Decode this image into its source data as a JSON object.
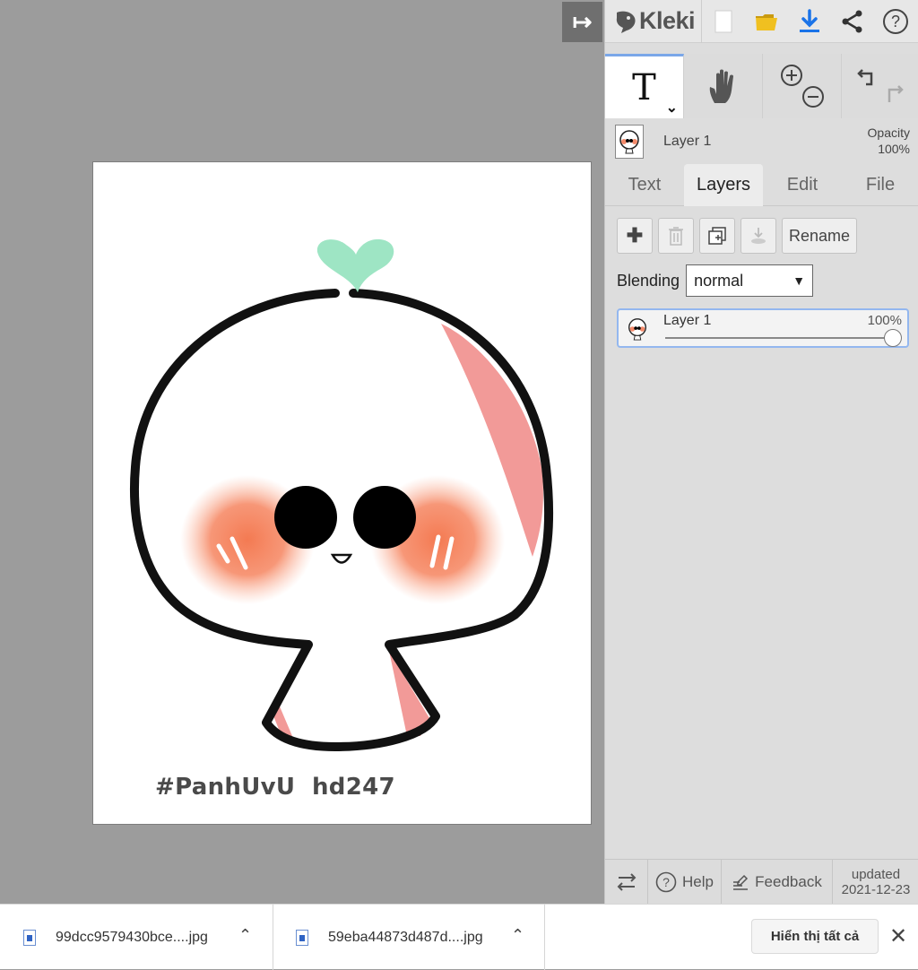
{
  "panel": {
    "app_name": "Kleki",
    "layer_name": "Layer 1",
    "opacity_label": "Opacity",
    "opacity_value": "100%",
    "tabs": [
      "Text",
      "Layers",
      "Edit",
      "File"
    ],
    "active_tab": "Layers",
    "rename_label": "Rename",
    "blending_label": "Blending",
    "blending_value": "normal",
    "layer_item": {
      "name": "Layer 1",
      "opacity": "100%",
      "opacity_fraction": 1.0
    },
    "help_label": "Help",
    "feedback_label": "Feedback",
    "updated_label": "updated",
    "updated_date": "2021-12-23"
  },
  "canvas": {
    "watermark": "#PanhUvU  hd247"
  },
  "downloads": {
    "file1": "99dcc9579430bce....jpg",
    "file2": "59eba44873d487d....jpg",
    "show_all": "Hiển thị tất cả"
  },
  "colors": {
    "accent": "#2f63c4",
    "download_icon": "#1a73e8",
    "folder": "#f0c020",
    "sprout": "#9ee5c4",
    "blush": "#f48a6a",
    "shade": "#f29a98"
  }
}
